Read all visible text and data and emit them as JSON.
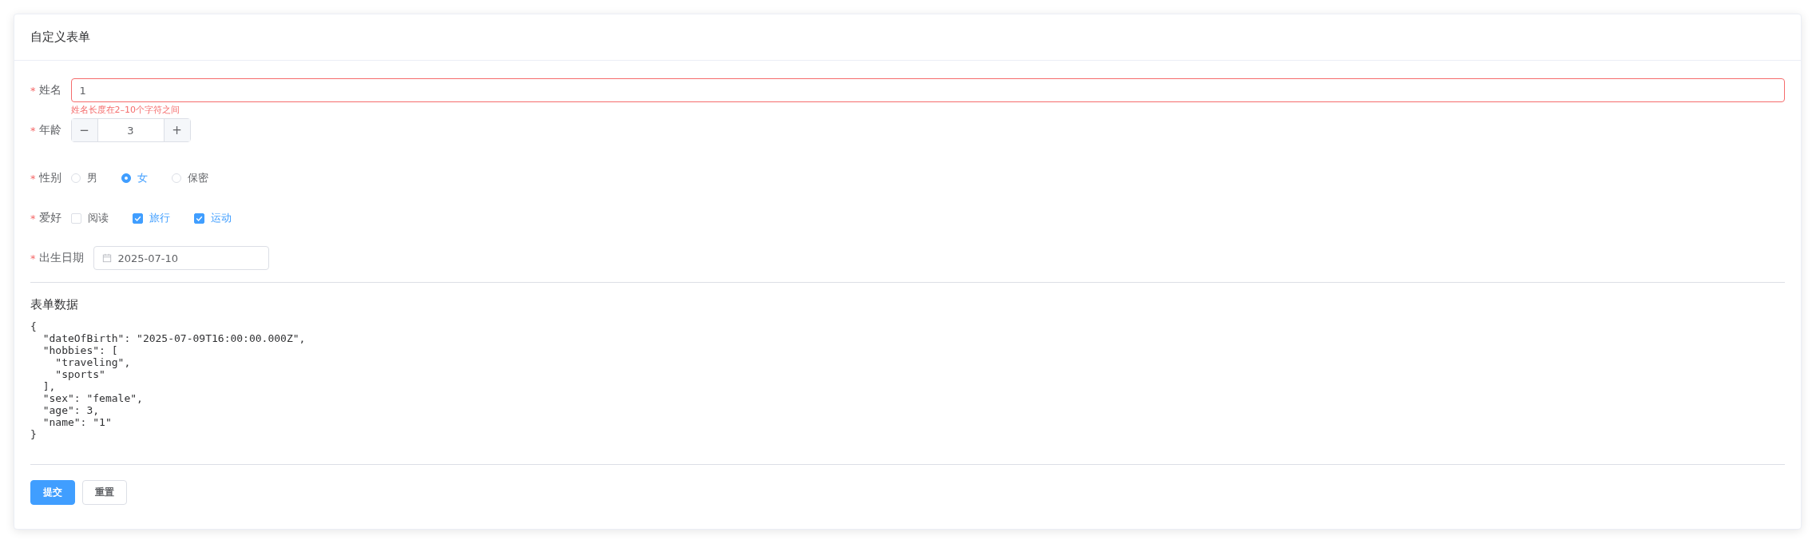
{
  "card": {
    "title": "自定义表单"
  },
  "required_mark": "*",
  "fields": [
    {
      "kind": "text",
      "label": "姓名",
      "required": true,
      "value": "1",
      "error": "姓名长度在2–10个字符之间"
    },
    {
      "kind": "number",
      "label": "年龄",
      "required": true,
      "value": "3",
      "minus": "−",
      "plus": "+"
    },
    {
      "kind": "radio",
      "label": "性别",
      "required": true,
      "options": [
        {
          "label": "男",
          "selected": false
        },
        {
          "label": "女",
          "selected": true
        },
        {
          "label": "保密",
          "selected": false
        }
      ]
    },
    {
      "kind": "checkbox",
      "label": "爱好",
      "required": true,
      "options": [
        {
          "label": "阅读",
          "checked": false
        },
        {
          "label": "旅行",
          "checked": true
        },
        {
          "label": "运动",
          "checked": true
        }
      ]
    },
    {
      "kind": "date",
      "label": "出生日期",
      "required": true,
      "value": "2025-07-10"
    }
  ],
  "data_section": {
    "title": "表单数据",
    "code": [
      "{",
      "  \"dateOfBirth\": \"2025-07-09T16:00:00.000Z\",",
      "  \"hobbies\": [",
      "    \"traveling\",",
      "    \"sports\"",
      "  ],",
      "  \"sex\": \"female\",",
      "  \"age\": 3,",
      "  \"name\": \"1\"",
      "}"
    ]
  },
  "buttons": [
    {
      "label": "提交",
      "kind": "primary"
    },
    {
      "label": "重置",
      "kind": "default"
    }
  ]
}
